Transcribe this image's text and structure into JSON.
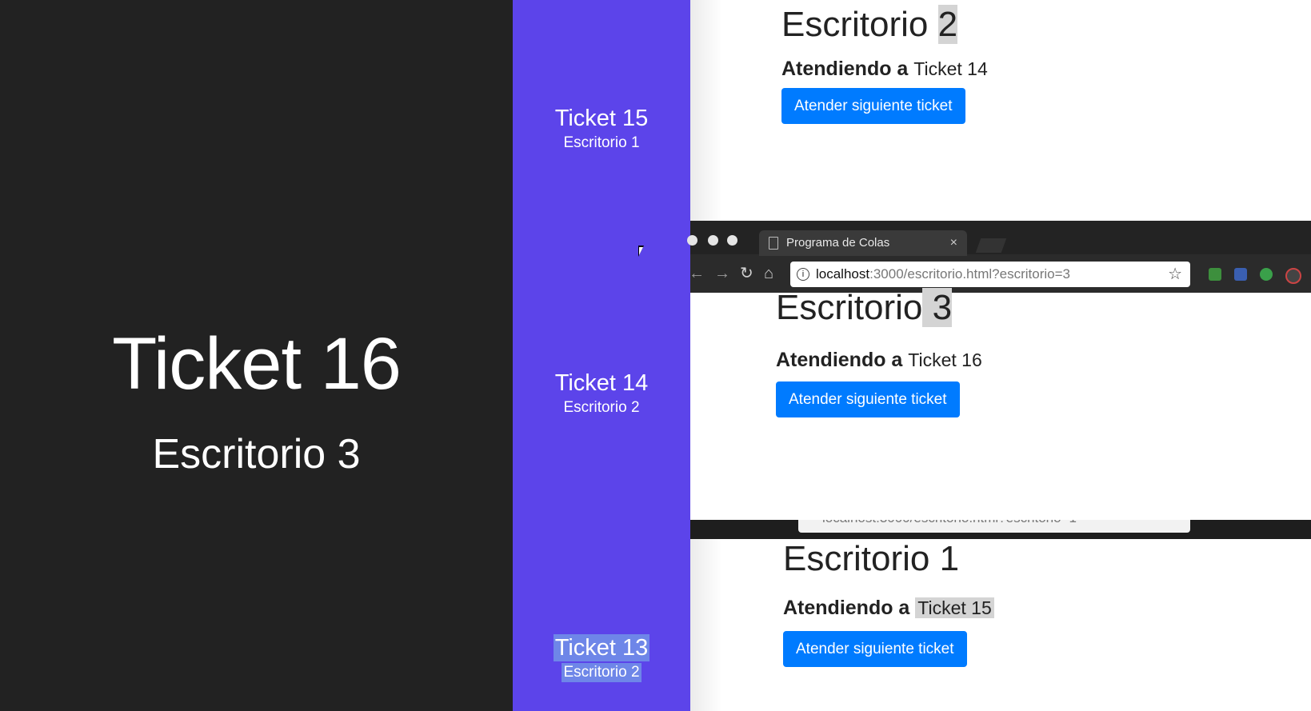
{
  "display": {
    "current_ticket": "Ticket 16",
    "current_desk": "Escritorio 3"
  },
  "history": [
    {
      "ticket": "Ticket 15",
      "desk": "Escritorio 1"
    },
    {
      "ticket": "Ticket 14",
      "desk": "Escritorio 2"
    },
    {
      "ticket": "Ticket 13",
      "desk": "Escritorio 2"
    }
  ],
  "windows": {
    "desk2": {
      "title_prefix": "Escritorio ",
      "title_number": "2",
      "serving_label": "Atendiendo a",
      "serving_ticket": "Ticket 14",
      "button_label": "Atender siguiente ticket"
    },
    "desk3": {
      "tab_title": "Programa de Colas",
      "tab_close": "×",
      "url_host": "localhost",
      "url_rest": ":3000/escritorio.html?escritorio=3",
      "title_prefix": "Escritorio",
      "title_number": " 3",
      "serving_label": "Atendiendo a",
      "serving_ticket": "Ticket 16",
      "button_label": "Atender siguiente ticket"
    },
    "desk1": {
      "url_partial": "localhost:3000/escritorio.html?escritorio=1",
      "title": "Escritorio 1",
      "serving_label": "Atendiendo a",
      "serving_ticket": "Ticket 15",
      "button_label": "Atender siguiente ticket"
    }
  },
  "colors": {
    "display_bg": "#222222",
    "history_bg": "#5c44ea",
    "button_bg": "#007bff"
  }
}
